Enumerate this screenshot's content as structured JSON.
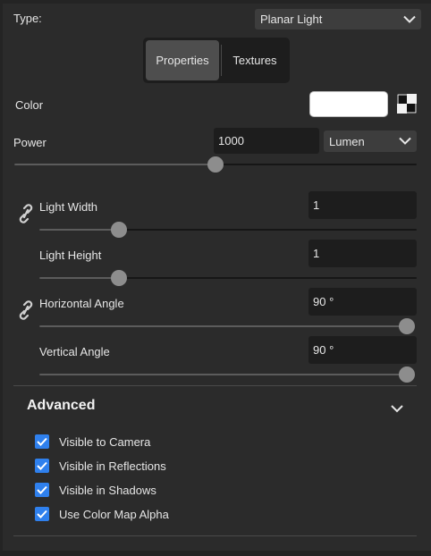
{
  "type_row": {
    "label": "Type:",
    "value": "Planar Light"
  },
  "tabs": [
    {
      "label": "Properties",
      "active": true
    },
    {
      "label": "Textures",
      "active": false
    }
  ],
  "color": {
    "label": "Color",
    "value": "#ffffff"
  },
  "power": {
    "label": "Power",
    "value": "1000",
    "unit": "Lumen",
    "level": 0.5
  },
  "light_width": {
    "label": "Light Width",
    "value": "1",
    "level": 0.21
  },
  "light_height": {
    "label": "Light Height",
    "value": "1",
    "level": 0.21
  },
  "horizontal_angle": {
    "label": "Horizontal Angle",
    "value": "90 °",
    "level": 1.0
  },
  "vertical_angle": {
    "label": "Vertical Angle",
    "value": "90 °",
    "level": 1.0
  },
  "advanced": {
    "title": "Advanced",
    "expanded": true,
    "checkboxes": [
      {
        "label": "Visible to Camera",
        "checked": true
      },
      {
        "label": "Visible in Reflections",
        "checked": true
      },
      {
        "label": "Visible in Shadows",
        "checked": true
      },
      {
        "label": "Use Color Map Alpha",
        "checked": true
      }
    ]
  },
  "icons": {
    "dropdown": "chevron-down-icon",
    "link": "link-icon",
    "color_picker": "checker-icon",
    "check": "check-icon"
  },
  "colors": {
    "panel_bg": "#2b2b2b",
    "input_bg": "#1d1d1d",
    "checkbox_accent": "#2f80ed",
    "slider_thumb": "#8d8d8d"
  }
}
